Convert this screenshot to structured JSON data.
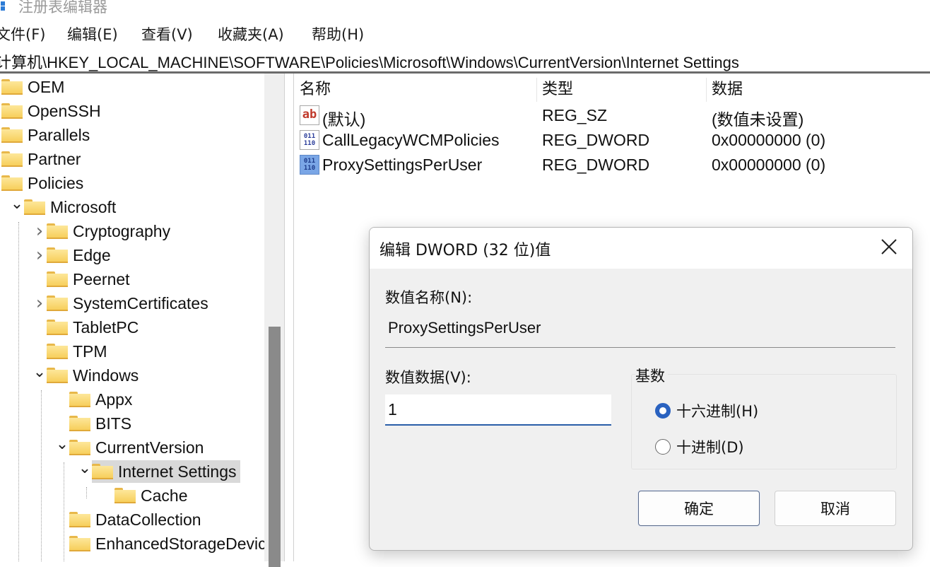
{
  "window": {
    "title": "注册表编辑器"
  },
  "menu": [
    {
      "label": "文件(F)"
    },
    {
      "label": "编辑(E)"
    },
    {
      "label": "查看(V)"
    },
    {
      "label": "收藏夹(A)"
    },
    {
      "label": "帮助(H)"
    }
  ],
  "address": {
    "path": "计算机\\HKEY_LOCAL_MACHINE\\SOFTWARE\\Policies\\Microsoft\\Windows\\CurrentVersion\\Internet Settings"
  },
  "tree": {
    "items": [
      {
        "label": "OEM",
        "expander": "none"
      },
      {
        "label": "OpenSSH",
        "expander": "none"
      },
      {
        "label": "Parallels",
        "expander": "none"
      },
      {
        "label": "Partner",
        "expander": "none"
      },
      {
        "label": "Policies",
        "expander": "none"
      },
      {
        "label": "Microsoft",
        "expander": "expanded"
      },
      {
        "label": "Cryptography",
        "expander": "collapsed"
      },
      {
        "label": "Edge",
        "expander": "collapsed"
      },
      {
        "label": "Peernet",
        "expander": "none"
      },
      {
        "label": "SystemCertificates",
        "expander": "collapsed"
      },
      {
        "label": "TabletPC",
        "expander": "none"
      },
      {
        "label": "TPM",
        "expander": "none"
      },
      {
        "label": "Windows",
        "expander": "expanded"
      },
      {
        "label": "Appx",
        "expander": "none"
      },
      {
        "label": "BITS",
        "expander": "none"
      },
      {
        "label": "CurrentVersion",
        "expander": "expanded"
      },
      {
        "label": "Internet Settings",
        "expander": "expanded",
        "selected": true
      },
      {
        "label": "Cache",
        "expander": "none"
      },
      {
        "label": "DataCollection",
        "expander": "none"
      },
      {
        "label": "EnhancedStorageDevic",
        "expander": "none"
      }
    ]
  },
  "list": {
    "columns": [
      "名称",
      "类型",
      "数据"
    ],
    "rows": [
      {
        "name": "(默认)",
        "type": "REG_SZ",
        "data": "(数值未设置)",
        "icon": "string-value-icon"
      },
      {
        "name": "CallLegacyWCMPolicies",
        "type": "REG_DWORD",
        "data": "0x00000000 (0)",
        "icon": "binary-value-icon"
      },
      {
        "name": "ProxySettingsPerUser",
        "type": "REG_DWORD",
        "data": "0x00000000 (0)",
        "icon": "binary-value-icon",
        "selected": true
      }
    ]
  },
  "dialog": {
    "title": "编辑 DWORD (32 位)值",
    "name_label": "数值名称(N):",
    "name_value": "ProxySettingsPerUser",
    "data_label": "数值数据(V):",
    "data_value": "1",
    "base_label": "基数",
    "radios": [
      {
        "label": "十六进制(H)",
        "checked": true
      },
      {
        "label": "十进制(D)",
        "checked": false
      }
    ],
    "ok_label": "确定",
    "cancel_label": "取消"
  },
  "colors": {
    "accent": "#2a62c0",
    "selection": "#d9d9d9",
    "folder": "#f7cf5c"
  }
}
